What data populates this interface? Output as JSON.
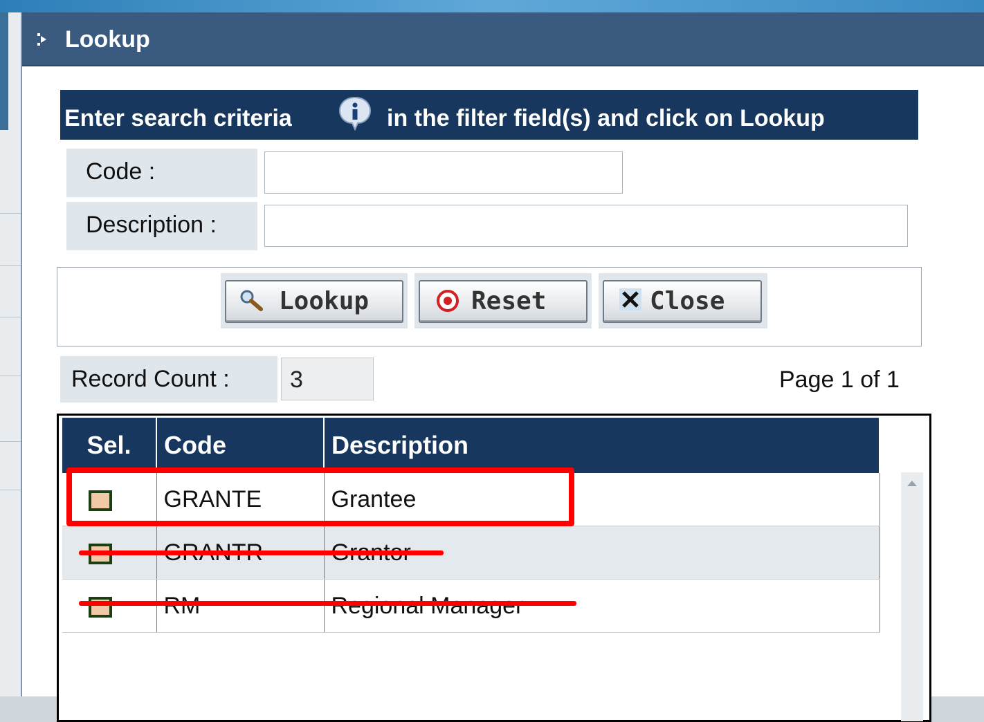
{
  "dialog": {
    "title": "Lookup",
    "criteria_text_before": "Enter search criteria",
    "criteria_text_after": "in the filter field(s) and click on Lookup",
    "accent_color": "#17375e",
    "title_bar_color": "#3b5a80"
  },
  "filters": {
    "code_label": "Code :",
    "code_value": "",
    "description_label": "Description :",
    "description_value": ""
  },
  "buttons": {
    "lookup_label": "Lookup",
    "reset_label": "Reset",
    "close_label": "Close"
  },
  "results": {
    "record_count_label": "Record Count :",
    "record_count_value": "3",
    "page_info": "Page 1 of 1",
    "columns": [
      "Sel.",
      "Code",
      "Description"
    ],
    "rows": [
      {
        "code": "GRANTE",
        "description": "Grantee"
      },
      {
        "code": "GRANTR",
        "description": "Grantor"
      },
      {
        "code": "RM",
        "description": "Regional Manager"
      }
    ]
  },
  "annotations": {
    "highlight_color": "#ff0000",
    "highlighted_row": "GRANTE",
    "struck_rows": [
      "GRANTR",
      "RM"
    ]
  }
}
